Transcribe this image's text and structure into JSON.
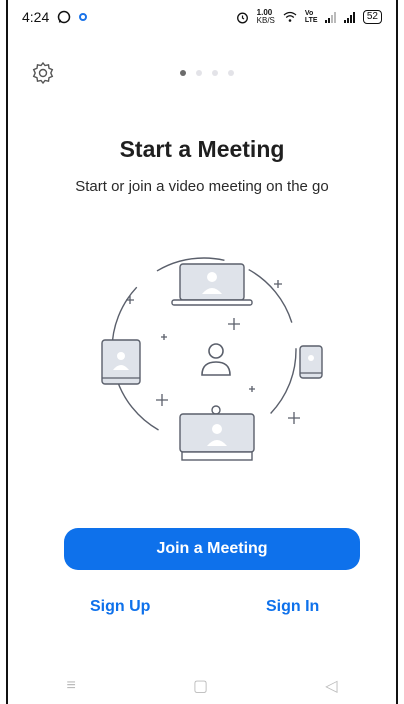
{
  "status": {
    "time": "4:24",
    "speed_value": "1.00",
    "speed_unit": "KB/S",
    "volte": "Vo LTE",
    "battery": "52"
  },
  "icons": {
    "settings": "gear-icon",
    "whatsapp": "whatsapp-icon",
    "alarm": "alarm-icon",
    "wifi": "wifi-icon",
    "signal": "signal-icon",
    "battery": "battery-icon"
  },
  "pager": {
    "total": 4,
    "active": 0
  },
  "onboarding": {
    "title": "Start a Meeting",
    "subtitle": "Start or join a video meeting on the go"
  },
  "actions": {
    "join_label": "Join a Meeting",
    "signup_label": "Sign Up",
    "signin_label": "Sign In"
  },
  "nav": {
    "menu": "≡",
    "home": "▢",
    "back": "◁"
  },
  "colors": {
    "accent": "#0e71eb",
    "illustration_stroke": "#5a5f6b",
    "illustration_fill": "#dfe3ea"
  }
}
